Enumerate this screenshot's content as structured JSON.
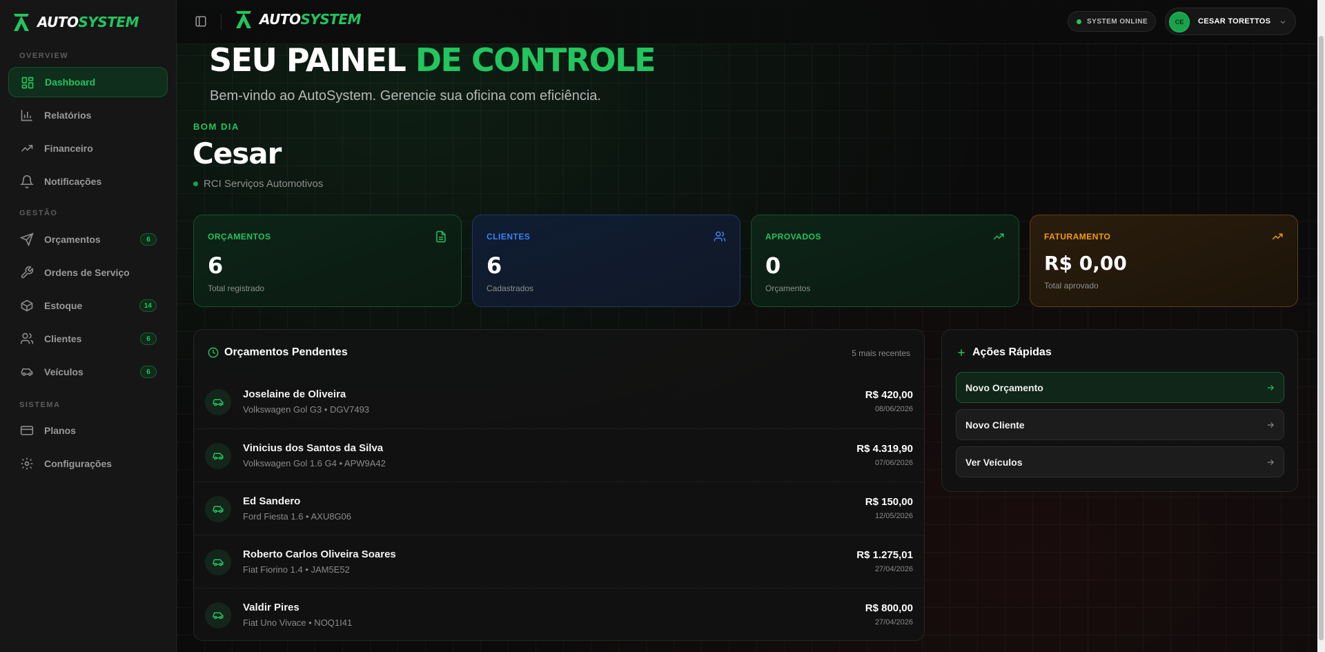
{
  "brand": {
    "name_part1": "AUTO",
    "name_part2": "SYSTEM"
  },
  "sidebar": {
    "sections": [
      {
        "title": "OVERVIEW"
      },
      {
        "title": "GESTÃO"
      },
      {
        "title": "SISTEMA"
      }
    ],
    "items": [
      {
        "label": "Dashboard",
        "icon": "layout-grid-icon",
        "active": true
      },
      {
        "label": "Relatórios",
        "icon": "bar-chart-icon"
      },
      {
        "label": "Financeiro",
        "icon": "trending-up-icon"
      },
      {
        "label": "Notificações",
        "icon": "bell-icon"
      },
      {
        "label": "Orçamentos",
        "icon": "send-icon",
        "badge": "6"
      },
      {
        "label": "Ordens de Serviço",
        "icon": "wrench-icon"
      },
      {
        "label": "Estoque",
        "icon": "box-icon",
        "badge": "14"
      },
      {
        "label": "Clientes",
        "icon": "users-icon",
        "badge": "6"
      },
      {
        "label": "Veículos",
        "icon": "car-icon",
        "badge": "6"
      },
      {
        "label": "Planos",
        "icon": "credit-card-icon"
      },
      {
        "label": "Configurações",
        "icon": "gear-icon"
      }
    ]
  },
  "topbar": {
    "status": "SYSTEM ONLINE",
    "user": {
      "initials": "CE",
      "name": "CESAR TORETTOS"
    }
  },
  "hero": {
    "title_part1": "SEU PAINEL",
    "title_part2": "DE CONTROLE",
    "subtitle": "Bem-vindo ao AutoSystem. Gerencie sua oficina com eficiência."
  },
  "greeting": {
    "label": "BOM DIA",
    "name": "Cesar",
    "company": "RCI Serviços Automotivos"
  },
  "stats": [
    {
      "label": "ORÇAMENTOS",
      "value": "6",
      "sub": "Total registrado",
      "icon": "file-text-icon",
      "color": "#22c55e"
    },
    {
      "label": "CLIENTES",
      "value": "6",
      "sub": "Cadastrados",
      "icon": "users-icon",
      "color": "#3b82f6"
    },
    {
      "label": "APROVADOS",
      "value": "0",
      "sub": "Orçamentos",
      "icon": "trending-up-icon",
      "color": "#22c55e"
    },
    {
      "label": "FATURAMENTO",
      "value": "R$ 0,00",
      "sub": "Total aprovado",
      "icon": "trending-up-icon",
      "color": "#f59e0b"
    }
  ],
  "pending": {
    "title": "Orçamentos Pendentes",
    "meta": "5 mais recentes",
    "rows": [
      {
        "name": "Joselaine de Oliveira",
        "car": "Volkswagen Gol G3 • DGV7493",
        "amount": "R$ 420,00",
        "date": "08/06/2026"
      },
      {
        "name": "Vinicius dos Santos da Silva",
        "car": "Volkswagen Gol 1.6 G4 • APW9A42",
        "amount": "R$ 4.319,90",
        "date": "07/06/2026"
      },
      {
        "name": "Ed Sandero",
        "car": "Ford Fiesta 1.6 • AXU8G06",
        "amount": "R$ 150,00",
        "date": "12/05/2026"
      },
      {
        "name": "Roberto Carlos Oliveira Soares",
        "car": "Fiat Fiorino 1.4 • JAM5E52",
        "amount": "R$ 1.275,01",
        "date": "27/04/2026"
      },
      {
        "name": "Valdir Pires",
        "car": "Fiat Uno Vivace • NOQ1I41",
        "amount": "R$ 800,00",
        "date": "27/04/2026"
      }
    ]
  },
  "quick_actions": {
    "title": "Ações Rápidas",
    "items": [
      {
        "label": "Novo Orçamento",
        "primary": true
      },
      {
        "label": "Novo Cliente"
      },
      {
        "label": "Ver Veículos"
      }
    ]
  }
}
